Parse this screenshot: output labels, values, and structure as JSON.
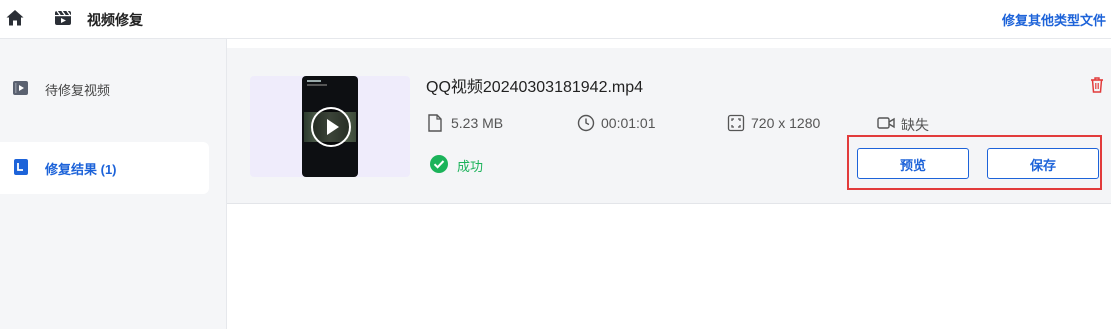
{
  "header": {
    "app_title": "视频修复",
    "other_types_link": "修复其他类型文件",
    "home_icon": "home-icon",
    "app_icon": "video-clapper-icon"
  },
  "sidebar": {
    "items": [
      {
        "label": "待修复视频",
        "icon": "video-file-icon",
        "active": false
      },
      {
        "label": "修复结果 (1)",
        "icon": "result-file-icon",
        "active": true
      }
    ]
  },
  "result": {
    "file_name": "QQ视频20240303181942.mp4",
    "size": "5.23  MB",
    "duration": "00:01:01",
    "resolution": "720 x 1280",
    "audio": "缺失",
    "status": "成功",
    "preview_label": "预览",
    "save_label": "保存"
  },
  "colors": {
    "accent": "#1d63d9",
    "success": "#1bb35a",
    "danger": "#e23b3b",
    "sidebar_bg": "#f5f6f8"
  }
}
